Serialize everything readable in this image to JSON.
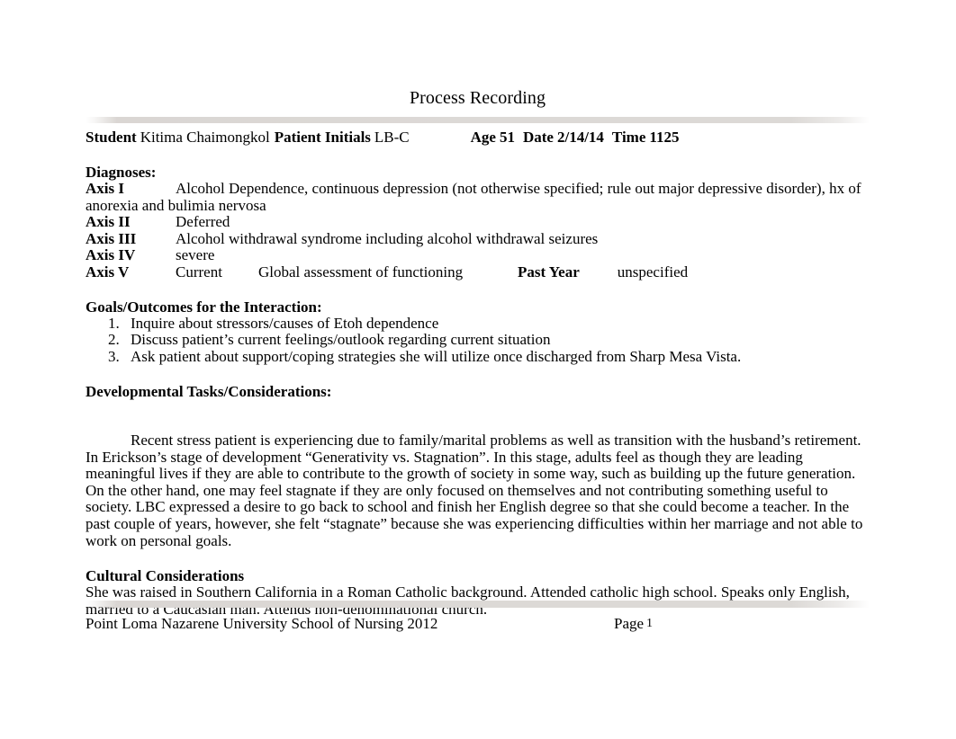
{
  "document": {
    "title": "Process Recording",
    "header": {
      "student_label": "Student",
      "student_name": "Kitima Chaimongkol",
      "patient_initials_label": "Patient Initials",
      "patient_initials_value": "LB-C",
      "age_label": "Age",
      "age_value": "51",
      "date_label": "Date",
      "date_value": "2/14/14",
      "time_label": "Time",
      "time_value": "1125"
    },
    "diagnoses": {
      "heading": "Diagnoses:",
      "axes": [
        {
          "label": "Axis I",
          "value": "Alcohol Dependence, continuous depression (not otherwise specified; rule out major depressive disorder), hx of anorexia and bulimia nervosa"
        },
        {
          "label": "Axis II",
          "value": "Deferred"
        },
        {
          "label": "Axis III",
          "value": "Alcohol withdrawal syndrome including alcohol withdrawal seizures"
        },
        {
          "label": "Axis IV",
          "value": "severe"
        }
      ],
      "axis_v": {
        "label": "Axis V",
        "current_label": "Current",
        "gaf_text": "Global assessment of functioning",
        "past_year_label": "Past Year",
        "past_year_value": "unspecified"
      }
    },
    "goals": {
      "heading": "Goals/Outcomes for the Interaction:",
      "items": [
        {
          "num": "1.",
          "text": "Inquire about stressors/causes of Etoh dependence"
        },
        {
          "num": "2.",
          "text": "Discuss patient’s current feelings/outlook regarding current situation"
        },
        {
          "num": "3.",
          "text": "Ask patient about support/coping strategies she will utilize once discharged from Sharp Mesa Vista."
        }
      ]
    },
    "developmental": {
      "heading": "Developmental Tasks/Considerations:",
      "paragraph": "Recent stress patient is experiencing due to family/marital problems as well as transition with the husband’s retirement. In Erickson’s stage of development “Generativity vs. Stagnation”. In this stage, adults feel as though they are leading meaningful lives if they are able to contribute to the growth of society in some way, such as building up the future generation. On the other hand, one may feel stagnate if they are only focused on themselves and not contributing something useful to society. LBC expressed a desire to go back to school and finish her English degree so that she could become a teacher.  In the past couple of years, however, she felt “stagnate” because she was experiencing difficulties within her marriage and not able to work on personal goals."
    },
    "cultural": {
      "heading": "Cultural Considerations",
      "paragraph": "She was raised in Southern California in a Roman Catholic background. Attended catholic high school. Speaks only English, married to a Caucasian man. Attends non-denominational church."
    },
    "footer": {
      "institution": "Point Loma Nazarene University School of Nursing 2012",
      "page_label": "Page",
      "page_number": "1"
    },
    "colors": {
      "text": "#000000",
      "rule_bar": "#dcd9d6",
      "background": "#ffffff"
    }
  }
}
